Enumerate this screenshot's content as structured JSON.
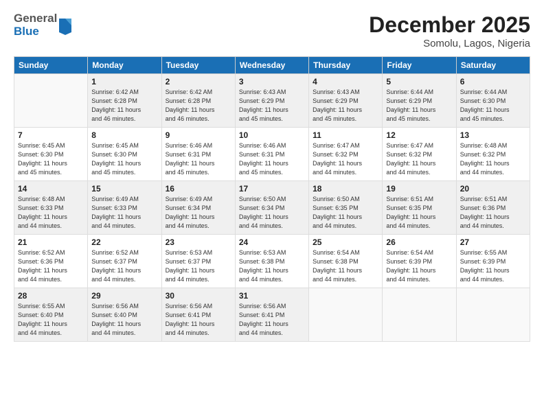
{
  "header": {
    "logo_general": "General",
    "logo_blue": "Blue",
    "month_year": "December 2025",
    "location": "Somolu, Lagos, Nigeria"
  },
  "days_of_week": [
    "Sunday",
    "Monday",
    "Tuesday",
    "Wednesday",
    "Thursday",
    "Friday",
    "Saturday"
  ],
  "weeks": [
    [
      {
        "day": "",
        "info": ""
      },
      {
        "day": "1",
        "info": "Sunrise: 6:42 AM\nSunset: 6:28 PM\nDaylight: 11 hours\nand 46 minutes."
      },
      {
        "day": "2",
        "info": "Sunrise: 6:42 AM\nSunset: 6:28 PM\nDaylight: 11 hours\nand 46 minutes."
      },
      {
        "day": "3",
        "info": "Sunrise: 6:43 AM\nSunset: 6:29 PM\nDaylight: 11 hours\nand 45 minutes."
      },
      {
        "day": "4",
        "info": "Sunrise: 6:43 AM\nSunset: 6:29 PM\nDaylight: 11 hours\nand 45 minutes."
      },
      {
        "day": "5",
        "info": "Sunrise: 6:44 AM\nSunset: 6:29 PM\nDaylight: 11 hours\nand 45 minutes."
      },
      {
        "day": "6",
        "info": "Sunrise: 6:44 AM\nSunset: 6:30 PM\nDaylight: 11 hours\nand 45 minutes."
      }
    ],
    [
      {
        "day": "7",
        "info": "Sunrise: 6:45 AM\nSunset: 6:30 PM\nDaylight: 11 hours\nand 45 minutes."
      },
      {
        "day": "8",
        "info": "Sunrise: 6:45 AM\nSunset: 6:30 PM\nDaylight: 11 hours\nand 45 minutes."
      },
      {
        "day": "9",
        "info": "Sunrise: 6:46 AM\nSunset: 6:31 PM\nDaylight: 11 hours\nand 45 minutes."
      },
      {
        "day": "10",
        "info": "Sunrise: 6:46 AM\nSunset: 6:31 PM\nDaylight: 11 hours\nand 45 minutes."
      },
      {
        "day": "11",
        "info": "Sunrise: 6:47 AM\nSunset: 6:32 PM\nDaylight: 11 hours\nand 44 minutes."
      },
      {
        "day": "12",
        "info": "Sunrise: 6:47 AM\nSunset: 6:32 PM\nDaylight: 11 hours\nand 44 minutes."
      },
      {
        "day": "13",
        "info": "Sunrise: 6:48 AM\nSunset: 6:32 PM\nDaylight: 11 hours\nand 44 minutes."
      }
    ],
    [
      {
        "day": "14",
        "info": "Sunrise: 6:48 AM\nSunset: 6:33 PM\nDaylight: 11 hours\nand 44 minutes."
      },
      {
        "day": "15",
        "info": "Sunrise: 6:49 AM\nSunset: 6:33 PM\nDaylight: 11 hours\nand 44 minutes."
      },
      {
        "day": "16",
        "info": "Sunrise: 6:49 AM\nSunset: 6:34 PM\nDaylight: 11 hours\nand 44 minutes."
      },
      {
        "day": "17",
        "info": "Sunrise: 6:50 AM\nSunset: 6:34 PM\nDaylight: 11 hours\nand 44 minutes."
      },
      {
        "day": "18",
        "info": "Sunrise: 6:50 AM\nSunset: 6:35 PM\nDaylight: 11 hours\nand 44 minutes."
      },
      {
        "day": "19",
        "info": "Sunrise: 6:51 AM\nSunset: 6:35 PM\nDaylight: 11 hours\nand 44 minutes."
      },
      {
        "day": "20",
        "info": "Sunrise: 6:51 AM\nSunset: 6:36 PM\nDaylight: 11 hours\nand 44 minutes."
      }
    ],
    [
      {
        "day": "21",
        "info": "Sunrise: 6:52 AM\nSunset: 6:36 PM\nDaylight: 11 hours\nand 44 minutes."
      },
      {
        "day": "22",
        "info": "Sunrise: 6:52 AM\nSunset: 6:37 PM\nDaylight: 11 hours\nand 44 minutes."
      },
      {
        "day": "23",
        "info": "Sunrise: 6:53 AM\nSunset: 6:37 PM\nDaylight: 11 hours\nand 44 minutes."
      },
      {
        "day": "24",
        "info": "Sunrise: 6:53 AM\nSunset: 6:38 PM\nDaylight: 11 hours\nand 44 minutes."
      },
      {
        "day": "25",
        "info": "Sunrise: 6:54 AM\nSunset: 6:38 PM\nDaylight: 11 hours\nand 44 minutes."
      },
      {
        "day": "26",
        "info": "Sunrise: 6:54 AM\nSunset: 6:39 PM\nDaylight: 11 hours\nand 44 minutes."
      },
      {
        "day": "27",
        "info": "Sunrise: 6:55 AM\nSunset: 6:39 PM\nDaylight: 11 hours\nand 44 minutes."
      }
    ],
    [
      {
        "day": "28",
        "info": "Sunrise: 6:55 AM\nSunset: 6:40 PM\nDaylight: 11 hours\nand 44 minutes."
      },
      {
        "day": "29",
        "info": "Sunrise: 6:56 AM\nSunset: 6:40 PM\nDaylight: 11 hours\nand 44 minutes."
      },
      {
        "day": "30",
        "info": "Sunrise: 6:56 AM\nSunset: 6:41 PM\nDaylight: 11 hours\nand 44 minutes."
      },
      {
        "day": "31",
        "info": "Sunrise: 6:56 AM\nSunset: 6:41 PM\nDaylight: 11 hours\nand 44 minutes."
      },
      {
        "day": "",
        "info": ""
      },
      {
        "day": "",
        "info": ""
      },
      {
        "day": "",
        "info": ""
      }
    ]
  ]
}
